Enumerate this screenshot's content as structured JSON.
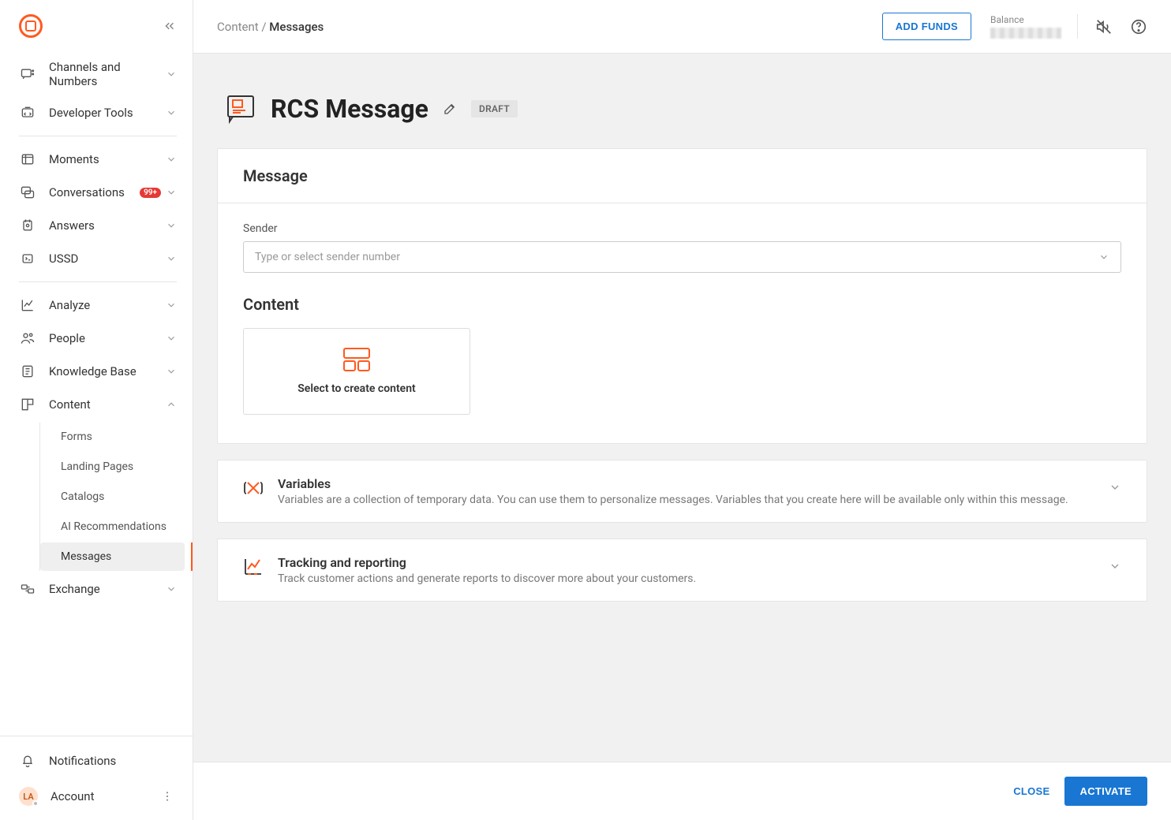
{
  "sidebar": {
    "items": [
      {
        "label": "Channels and Numbers"
      },
      {
        "label": "Developer Tools"
      },
      {
        "label": "Moments"
      },
      {
        "label": "Conversations",
        "badge": "99+"
      },
      {
        "label": "Answers"
      },
      {
        "label": "USSD"
      },
      {
        "label": "Analyze"
      },
      {
        "label": "People"
      },
      {
        "label": "Knowledge Base"
      },
      {
        "label": "Content"
      },
      {
        "label": "Exchange"
      }
    ],
    "content_subitems": [
      {
        "label": "Forms"
      },
      {
        "label": "Landing Pages"
      },
      {
        "label": "Catalogs"
      },
      {
        "label": "AI Recommendations"
      },
      {
        "label": "Messages"
      }
    ],
    "notifications_label": "Notifications",
    "account_label": "Account",
    "account_initials": "LA"
  },
  "topbar": {
    "breadcrumb_parent": "Content",
    "breadcrumb_sep": " / ",
    "breadcrumb_current": "Messages",
    "add_funds_label": "ADD FUNDS",
    "balance_label": "Balance"
  },
  "page": {
    "title": "RCS Message",
    "status_badge": "DRAFT"
  },
  "message_panel": {
    "header": "Message",
    "sender_label": "Sender",
    "sender_placeholder": "Type or select sender number",
    "content_header": "Content",
    "create_content_label": "Select to create content"
  },
  "variables_panel": {
    "title": "Variables",
    "description": "Variables are a collection of temporary data. You can use them to personalize messages. Variables that you create here will be available only within this message."
  },
  "tracking_panel": {
    "title": "Tracking and reporting",
    "description": "Track customer actions and generate reports to discover more about your customers."
  },
  "footer": {
    "close_label": "CLOSE",
    "activate_label": "ACTIVATE"
  }
}
